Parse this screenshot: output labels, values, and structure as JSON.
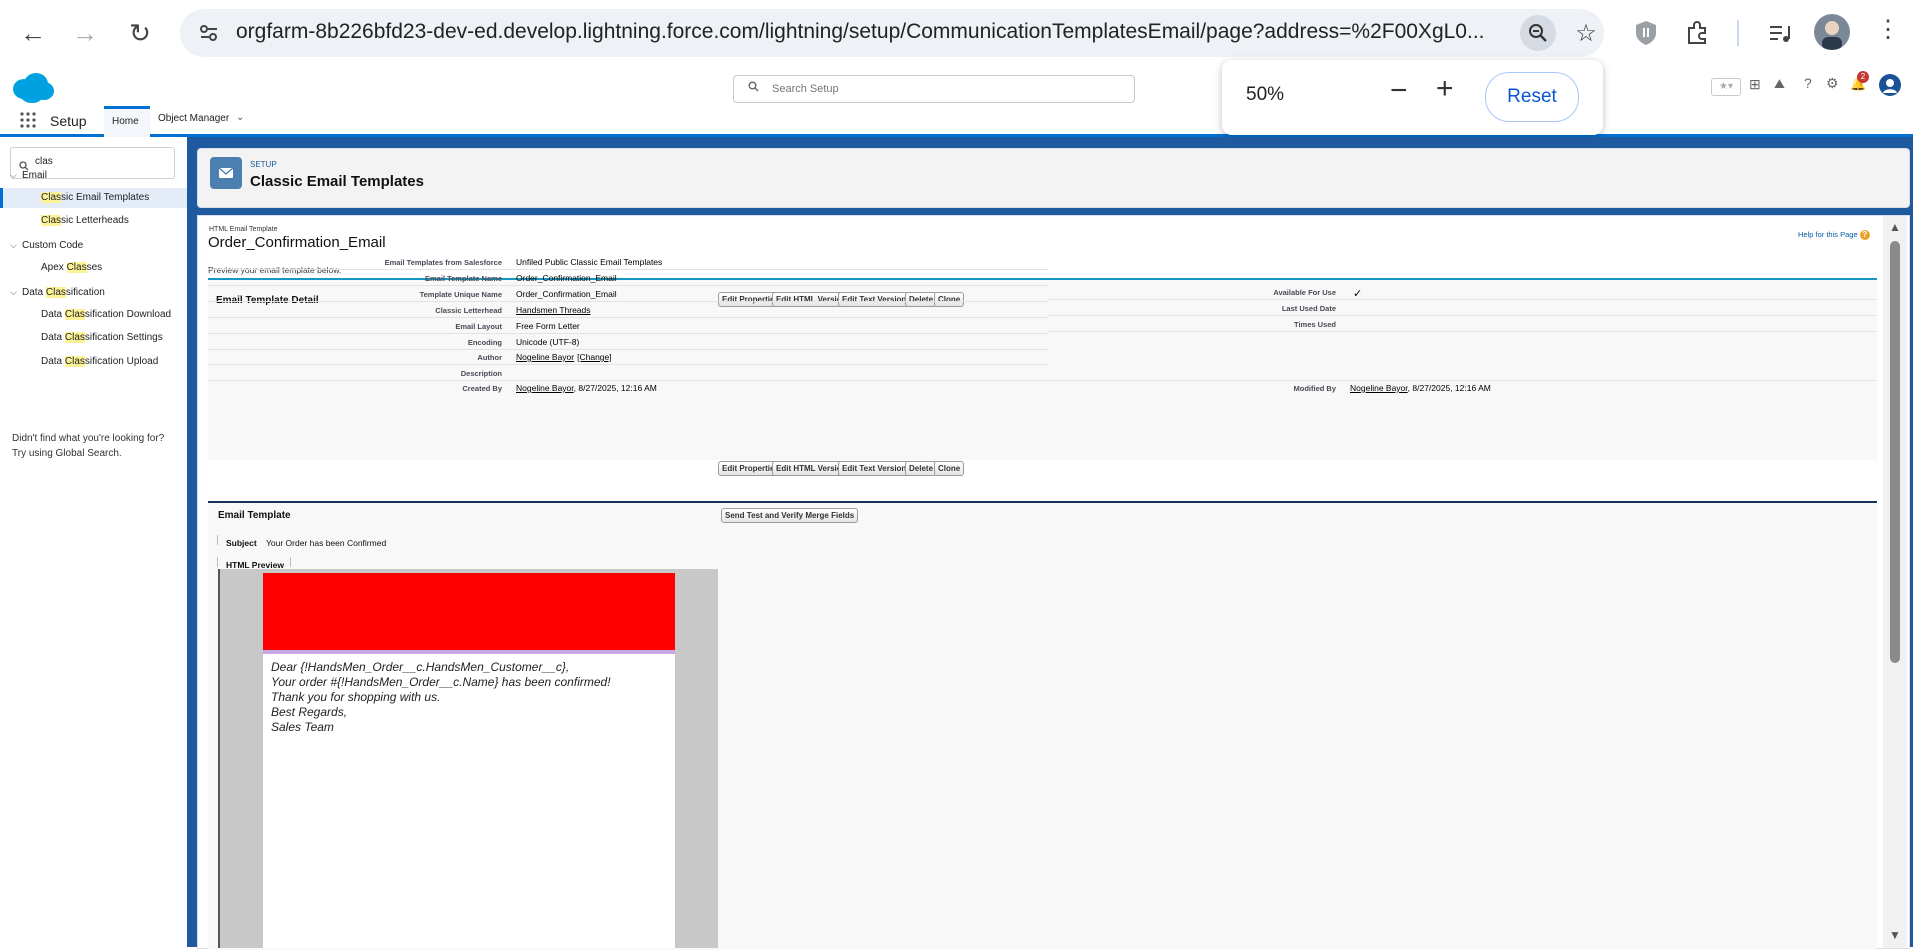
{
  "browser": {
    "url": "orgfarm-8b226bfd23-dev-ed.develop.lightning.force.com/lightning/setup/CommunicationTemplatesEmail/page?address=%2F00XgL0..."
  },
  "zoom": {
    "level": "50%",
    "reset_label": "Reset",
    "minus": "−",
    "plus": "+"
  },
  "sf_header": {
    "search_placeholder": "Search Setup",
    "app_name": "Setup",
    "tabs": [
      "Home",
      "Object Manager"
    ],
    "notification_count": "2"
  },
  "left_nav": {
    "quickfind_value": "clas",
    "items": [
      {
        "type": "group",
        "pre": "Email",
        "hl": "",
        "post": ""
      },
      {
        "type": "item",
        "pre": "",
        "hl": "Clas",
        "post": "sic Email Templates"
      },
      {
        "type": "item",
        "pre": "",
        "hl": "Clas",
        "post": "sic Letterheads"
      },
      {
        "type": "group",
        "pre": "Custom Code",
        "hl": "",
        "post": ""
      },
      {
        "type": "item",
        "pre": "Apex ",
        "hl": "Clas",
        "post": "ses"
      },
      {
        "type": "group",
        "pre": "Data ",
        "hl": "Clas",
        "post": "sification"
      },
      {
        "type": "item",
        "pre": "Data ",
        "hl": "Clas",
        "post": "sification Download"
      },
      {
        "type": "item",
        "pre": "Data ",
        "hl": "Clas",
        "post": "sification Settings"
      },
      {
        "type": "item",
        "pre": "Data ",
        "hl": "Clas",
        "post": "sification Upload"
      }
    ],
    "help_line1": "Didn't find what you're looking for?",
    "help_line2": "Try using Global Search."
  },
  "page_header": {
    "eyebrow": "SETUP",
    "title": "Classic Email Templates"
  },
  "detail": {
    "type_label": "HTML Email Template",
    "template_name": "Order_Confirmation_Email",
    "help_link": "Help for this Page",
    "preview_note": "Preview your email template below.",
    "section_title": "Email Template Detail",
    "buttons": [
      "Edit Properties",
      "Edit HTML Version",
      "Edit Text Version",
      "Delete",
      "Clone"
    ],
    "left_fields": [
      {
        "label": "Email Templates from Salesforce",
        "value": "Unfiled Public Classic Email Templates"
      },
      {
        "label": "Email Template Name",
        "value": "Order_Confirmation_Email"
      },
      {
        "label": "Template Unique Name",
        "value": "Order_Confirmation_Email"
      },
      {
        "label": "Classic Letterhead",
        "value": "Handsmen Threads"
      },
      {
        "label": "Email Layout",
        "value": "Free Form Letter"
      },
      {
        "label": "Encoding",
        "value": "Unicode (UTF-8)"
      },
      {
        "label": "Author",
        "value": "Nogeline Bayor",
        "extra": "[Change]"
      },
      {
        "label": "Description",
        "value": ""
      },
      {
        "label": "Created By",
        "value": "Nogeline Bayor",
        "extra": ", 8/27/2025, 12:16 AM"
      }
    ],
    "right_fields": [
      {
        "label": "Available For Use",
        "value": "✓"
      },
      {
        "label": "Last Used Date",
        "value": ""
      },
      {
        "label": "Times Used",
        "value": ""
      },
      {
        "label": "Modified By",
        "value": "Nogeline Bayor",
        "extra": ", 8/27/2025, 12:16 AM"
      }
    ]
  },
  "email_template": {
    "section_title": "Email Template",
    "send_test_label": "Send Test and Verify Merge Fields",
    "subject_label": "Subject",
    "subject_value": "Your Order has been Confirmed",
    "preview_label": "HTML Preview",
    "header_color": "#ff0000",
    "body_lines": [
      "Dear {!HandsMen_Order__c.HandsMen_Customer__c},",
      "Your order #{!HandsMen_Order__c.Name} has been confirmed!",
      "Thank you for shopping with us.",
      "Best Regards,",
      "Sales Team"
    ]
  }
}
